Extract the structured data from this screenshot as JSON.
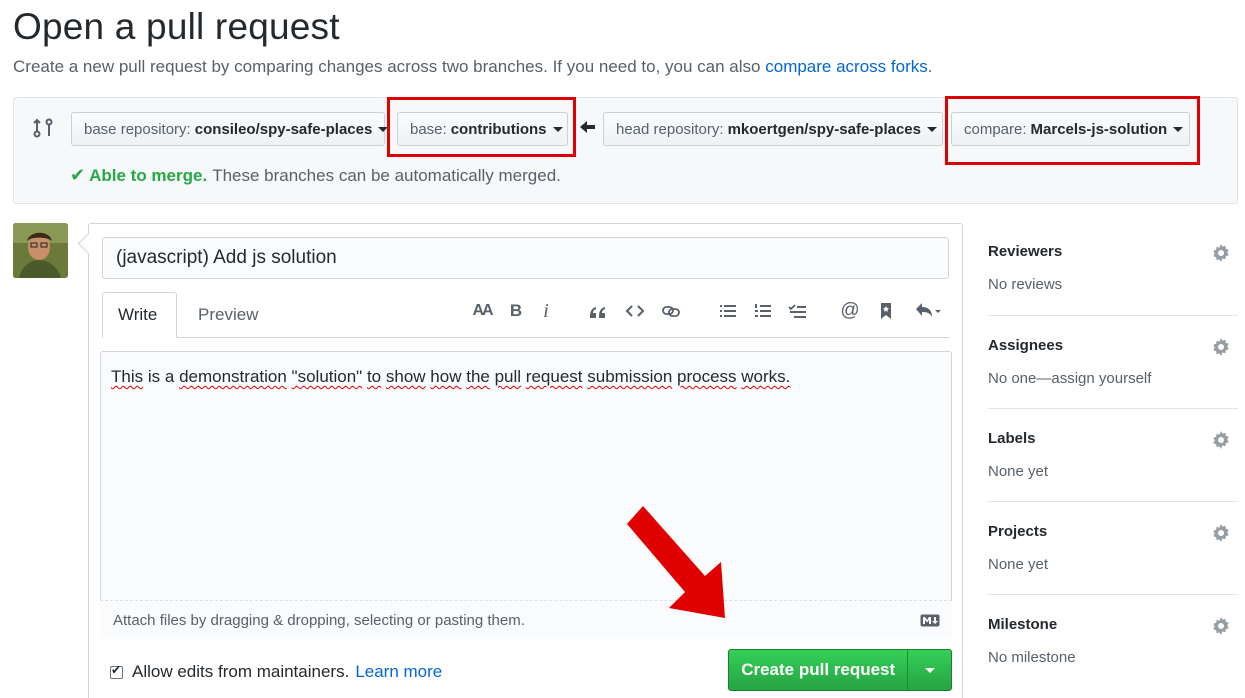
{
  "header": {
    "title": "Open a pull request",
    "subtitle": "Create a new pull request by comparing changes across two branches. If you need to, you can also",
    "subtitle_link": "compare across forks",
    "subtitle_end": "."
  },
  "range": {
    "base_repo_label": "base repository:",
    "base_repo_value": "consileo/spy-safe-places",
    "base_label": "base:",
    "base_value": "contributions",
    "head_repo_label": "head repository:",
    "head_repo_value": "mkoertgen/spy-safe-places",
    "compare_label": "compare:",
    "compare_value": "Marcels-js-solution",
    "merge_ok": "Able to merge.",
    "merge_text": "These branches can be automatically merged."
  },
  "form": {
    "title_value": "(javascript) Add js solution",
    "tab_write": "Write",
    "tab_preview": "Preview",
    "toolbar": {
      "heading": "AA",
      "bold": "B",
      "italic": "i"
    },
    "body_words": [
      "This",
      "is",
      "a",
      "demonstration",
      "\"solution\"",
      "to",
      "show",
      "how",
      "the",
      "pull",
      "request",
      "submission",
      "process",
      "works."
    ],
    "attach_text": "Attach files by dragging & dropping, selecting or pasting them.",
    "allow_edits_label": "Allow edits from maintainers.",
    "learn_more": "Learn more",
    "create_button": "Create pull request"
  },
  "sidebar": {
    "reviewers": {
      "heading": "Reviewers",
      "value": "No reviews"
    },
    "assignees": {
      "heading": "Assignees",
      "value": "No one—assign yourself"
    },
    "labels": {
      "heading": "Labels",
      "value": "None yet"
    },
    "projects": {
      "heading": "Projects",
      "value": "None yet"
    },
    "milestone": {
      "heading": "Milestone",
      "value": "No milestone"
    }
  },
  "colors": {
    "highlight": "#e00000",
    "create_button": "#28a745",
    "link": "#0366d6"
  },
  "icons": [
    "compare-arrows-icon",
    "arrow-left-icon",
    "check-icon",
    "heading-icon",
    "bold-icon",
    "italic-icon",
    "quote-icon",
    "code-icon",
    "link-icon",
    "unordered-list-icon",
    "ordered-list-icon",
    "task-list-icon",
    "mention-icon",
    "bookmark-icon",
    "reply-icon",
    "markdown-icon",
    "gear-icon"
  ]
}
